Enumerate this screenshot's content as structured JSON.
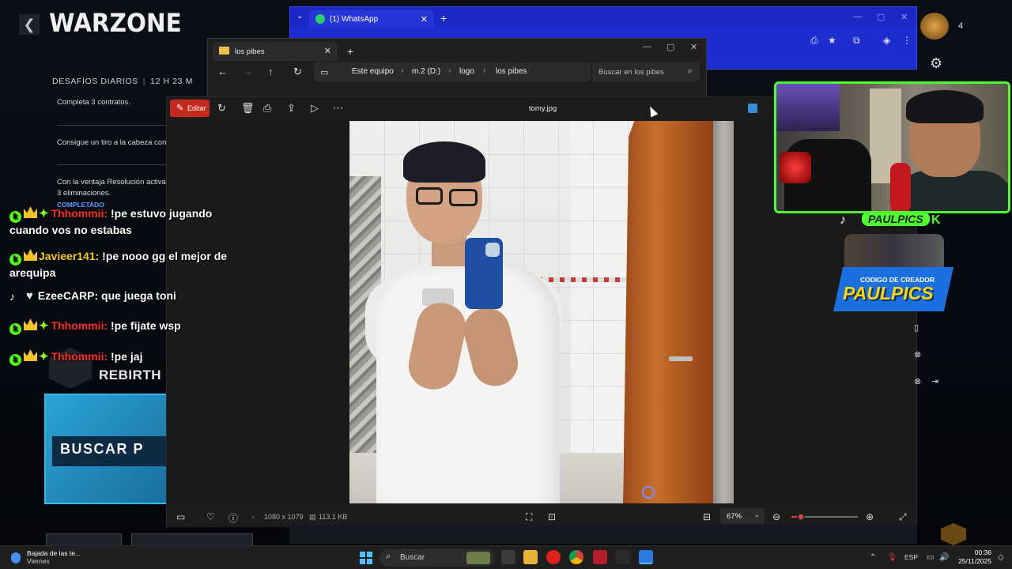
{
  "warzone": {
    "logo": "WARZONE",
    "back": "❮",
    "challenges_title": "DESAFÍOS DIARIOS",
    "challenges_timer": "12 H 23 M",
    "challenge_1": "Completa 3 contratos.",
    "challenge_2": "Consigue un tiro a la cabeza con un",
    "challenge_3a": "Con la ventaja Resolución activada",
    "challenge_3b": "3 eliminaciones.",
    "completed_label": "COMPLETADO",
    "rebirth_label": "REBIRTH ISL",
    "buscar_label": "BUSCAR P"
  },
  "chat": {
    "messages": [
      {
        "user": "Thhommii:",
        "text": " !pe estuvo jugando",
        "text2": "cuando vos no estabas",
        "user_color": "#ff2a2a"
      },
      {
        "user": "Javieer141:",
        "text": " !pe nooo gg el mejor de",
        "text2": "arequipa",
        "user_color": "#f5d300"
      },
      {
        "user": "EzeeCARP:",
        "text": " que juega toni",
        "user_color": "#ffffff"
      },
      {
        "user": "Thhommii:",
        "text": " !pe fijate wsp",
        "user_color": "#ff2a2a"
      },
      {
        "user": "Thhommii:",
        "text": " !pe jaj",
        "user_color": "#ff2a2a"
      }
    ],
    "badge_k": "k"
  },
  "whatsapp": {
    "tab_title": "(1) WhatsApp",
    "tab_close": "✕",
    "new_tab": "+",
    "tab_menu": "⌄"
  },
  "explorer": {
    "tab_title": "los pibes",
    "tab_close": "✕",
    "new_tab": "+",
    "breadcrumbs": [
      "Este equipo",
      "m.2 (D:)",
      "logo",
      "los pibes"
    ],
    "search_placeholder": "Buscar en los pibes"
  },
  "photos": {
    "edit_label": "Editar",
    "file_title": "tomy.jpg",
    "dimensions": "1080 x 1079",
    "file_size": "113.1 KB",
    "zoom_level": "67%",
    "zoom_fraction": 0.14
  },
  "streamer": {
    "name": "PAULPICS",
    "code_label": "CODIGO DE CREADOR",
    "code_name": "PAULPICS",
    "top_count": "4"
  },
  "taskbar": {
    "news_title": "Bajada de las te...",
    "news_sub": "Viernes",
    "search_label": "Buscar",
    "language": "ESP",
    "time": "00:36",
    "date": "25/11/2025"
  }
}
